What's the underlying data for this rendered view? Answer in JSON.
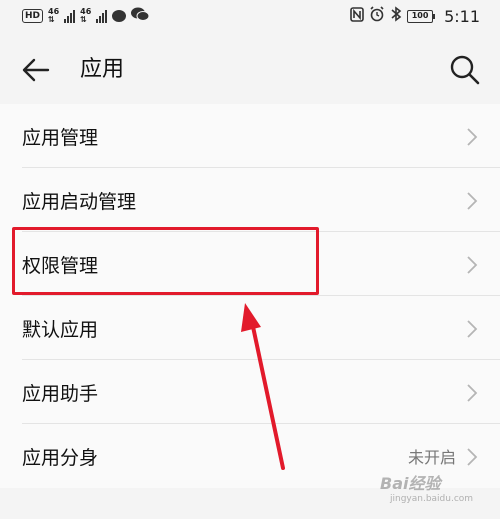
{
  "status_bar": {
    "badge": "HD",
    "network_1": "46",
    "network_2": "46",
    "battery_level": "100",
    "time": "5:11"
  },
  "header": {
    "title": "应用"
  },
  "menu": {
    "items": [
      {
        "label": "应用管理",
        "status": ""
      },
      {
        "label": "应用启动管理",
        "status": ""
      },
      {
        "label": "权限管理",
        "status": ""
      },
      {
        "label": "默认应用",
        "status": ""
      },
      {
        "label": "应用助手",
        "status": ""
      },
      {
        "label": "应用分身",
        "status": "未开启"
      }
    ]
  },
  "annotation": {
    "highlight_color": "#e21a2b"
  },
  "watermark": {
    "text": "Bai经验",
    "sub": "jingyan.baidu.com"
  }
}
